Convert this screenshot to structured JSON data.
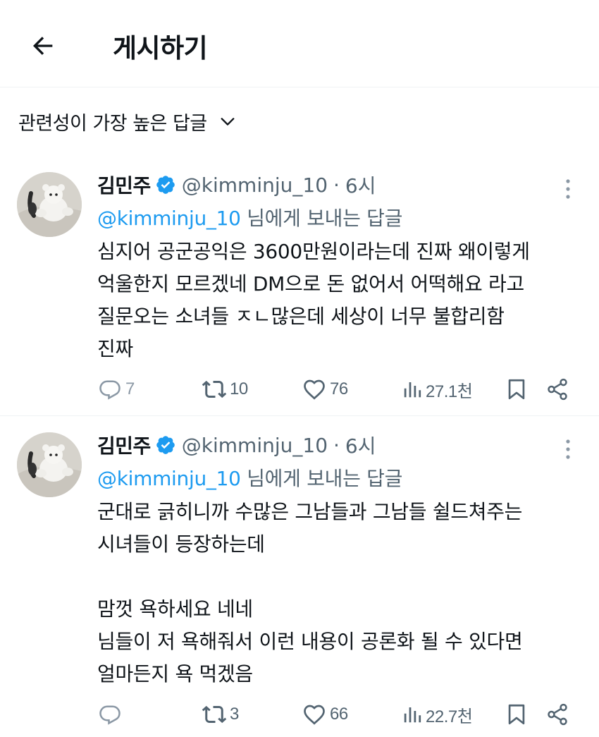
{
  "header": {
    "title": "게시하기"
  },
  "sort": {
    "label": "관련성이 가장 높은 답글"
  },
  "replies": [
    {
      "author": "김민주",
      "handle": "@kimminju_10",
      "dot": "·",
      "time": "6시",
      "replying_to": "@kimminju_10",
      "replying_suffix": " 님에게 보내는 답글",
      "text": "심지어 공군공익은 3600만원이라는데 진짜 왜이렇게\n억울한지 모르겠네 DM으로 돈 없어서 어떡해요 라고\n질문오는 소녀들 ㅈㄴ많은데 세상이 너무 불합리함\n진짜",
      "replies_count": "7",
      "retweets_count": "10",
      "likes_count": "76",
      "views_count": "27.1천"
    },
    {
      "author": "김민주",
      "handle": "@kimminju_10",
      "dot": "·",
      "time": "6시",
      "replying_to": "@kimminju_10",
      "replying_suffix": " 님에게 보내는 답글",
      "text": "군대로 긁히니까 수많은 그남들과 그남들 쉴드쳐주는\n시녀들이 등장하는데\n\n맘껏 욕하세요 네네\n님들이 저 욕해줘서 이런 내용이 공론화 될 수 있다면\n얼마든지 욕 먹겠음",
      "replies_count": "",
      "retweets_count": "3",
      "likes_count": "66",
      "views_count": "22.7천"
    }
  ],
  "colors": {
    "accent": "#1d9bf0",
    "muted": "#536471",
    "text": "#0f1419",
    "divider": "#eff3f4"
  },
  "icons": [
    "back-arrow-icon",
    "chevron-down-icon",
    "verified-badge-icon",
    "more-icon",
    "reply-icon",
    "retweet-icon",
    "like-icon",
    "views-icon",
    "bookmark-icon",
    "share-icon"
  ]
}
